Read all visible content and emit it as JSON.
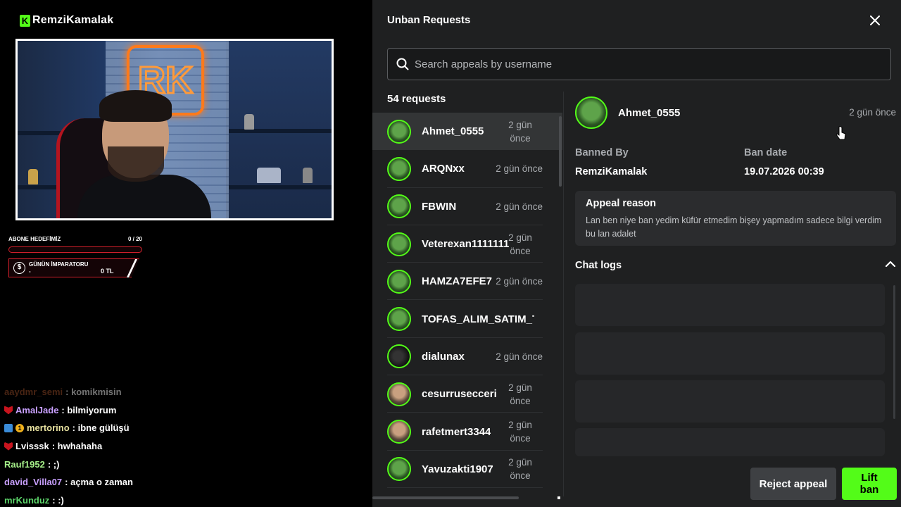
{
  "stream": {
    "brand_name": "RemziKamalak",
    "goal": {
      "label": "ABONE HEDEFİMİZ",
      "progress_text": "0 / 20",
      "progress": 0
    },
    "emperor": {
      "label": "GÜNÜN İMPARATORU",
      "name": "-",
      "amount": "0 TL"
    },
    "chat": [
      {
        "user": "aaydmr_semi",
        "text": ": komikmisin",
        "color": "#a0502a",
        "badges": [],
        "faded": true
      },
      {
        "user": "AmalJade",
        "text": ": bilmiyorum",
        "color": "#c9a0ff",
        "badges": [
          "red"
        ]
      },
      {
        "user": "mertorino",
        "text": ": ibne gülüşü",
        "color": "#e8e2a0",
        "badges": [
          "blue",
          "gold"
        ]
      },
      {
        "user": "Lvisssk",
        "text": ": hwhahaha",
        "color": "#ffffff",
        "badges": [
          "red"
        ]
      },
      {
        "user": "Rauf1952",
        "text": ": ;)",
        "color": "#a6f08a",
        "badges": []
      },
      {
        "user": "david_Villa07",
        "text": ": açma o zaman",
        "color": "#c9a0ff",
        "badges": []
      },
      {
        "user": "mrKunduz",
        "text": ": :)",
        "color": "#5dd66b",
        "badges": []
      }
    ]
  },
  "panel": {
    "title": "Unban Requests",
    "search_placeholder": "Search appeals by username",
    "count_label": "54 requests",
    "requests": [
      {
        "username": "Ahmet_0555",
        "when": "2 gün önce",
        "selected": true,
        "avatar": "green"
      },
      {
        "username": "ARQNxx",
        "when": "2 gün önce",
        "avatar": "green"
      },
      {
        "username": "FBWIN",
        "when": "2 gün önce",
        "avatar": "green"
      },
      {
        "username": "Veterexan1111111",
        "when": "2 gün önce",
        "avatar": "green"
      },
      {
        "username": "HAMZA7EFE7",
        "when": "2 gün önce",
        "avatar": "green"
      },
      {
        "username": "TOFAS_ALIM_SATIM_TAKAS",
        "when": "",
        "avatar": "green"
      },
      {
        "username": "dialunax",
        "when": "2 gün önce",
        "avatar": "dark"
      },
      {
        "username": "cesurrusecceri",
        "when": "2 gün önce",
        "avatar": "face"
      },
      {
        "username": "rafetmert3344",
        "when": "2 gün önce",
        "avatar": "face"
      },
      {
        "username": "Yavuzakti1907",
        "when": "2 gün önce",
        "avatar": "green"
      }
    ],
    "detail": {
      "username": "Ahmet_0555",
      "when": "2 gün önce",
      "banned_by_label": "Banned By",
      "banned_by": "RemziKamalak",
      "ban_date_label": "Ban date",
      "ban_date": "19.07.2026 00:39",
      "appeal_reason_label": "Appeal reason",
      "appeal_reason": "Lan ben niye ban yedim küfür etmedim bişey yapmadım sadece bilgi verdim bu lan adalet",
      "chat_logs_label": "Chat logs"
    },
    "actions": {
      "reject": "Reject appeal",
      "lift": "Lift ban"
    }
  },
  "colors": {
    "accent": "#53fc18",
    "panel_bg": "#1f2021",
    "goal_red": "#d11f2b"
  }
}
